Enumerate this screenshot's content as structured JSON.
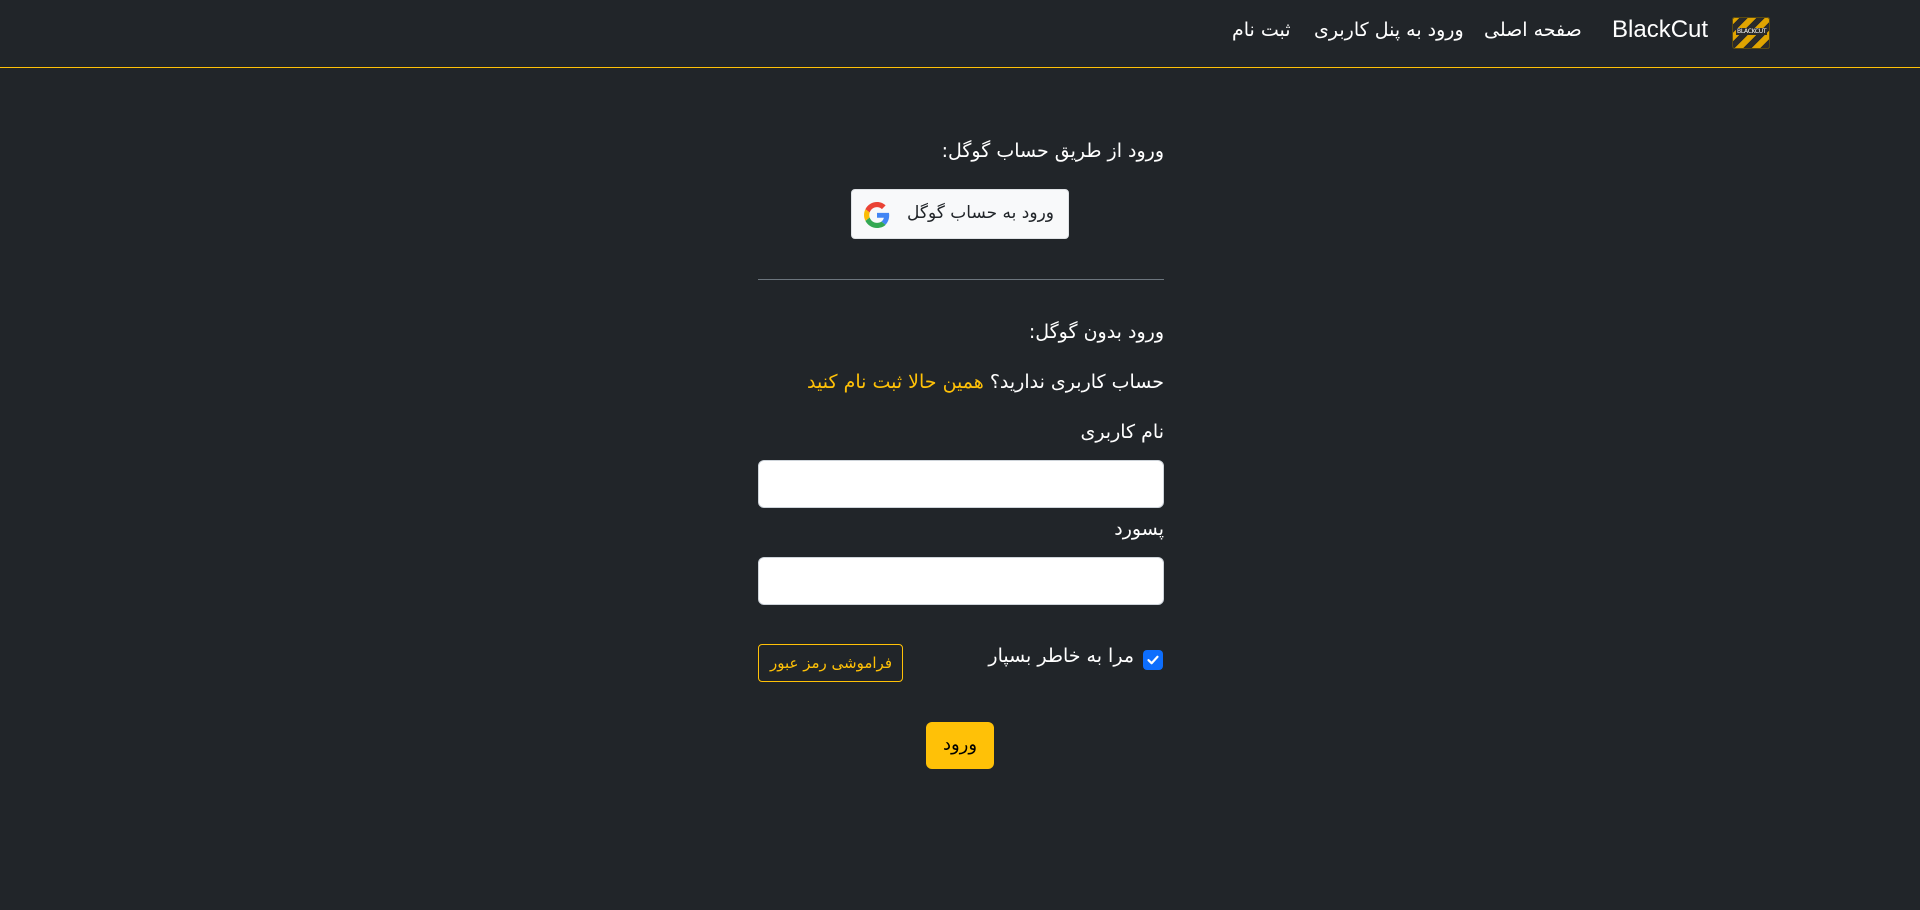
{
  "nav": {
    "brand": "BlackCut",
    "logo_text": "BLACKCUT",
    "links": [
      "صفحه اصلی",
      "ورود به پنل کاربری",
      "ثبت نام"
    ]
  },
  "google_section": {
    "heading": "ورود از طریق حساب گوگل:",
    "button_label": "ورود به حساب گوگل"
  },
  "login": {
    "heading": "ورود بدون گوگل:",
    "no_account_text": "حساب کاربری ندارید؟",
    "register_link": "همین حالا ثبت نام کنید",
    "username_label": "نام کاربری",
    "username_value": "",
    "password_label": "پسورد",
    "password_value": "",
    "remember_label": "مرا به خاطر بسپار",
    "forgot_label": "فراموشی رمز عبور",
    "submit_label": "ورود"
  },
  "colors": {
    "background": "#212529",
    "accent": "#ffc107",
    "checkbox": "#0d6efd"
  }
}
